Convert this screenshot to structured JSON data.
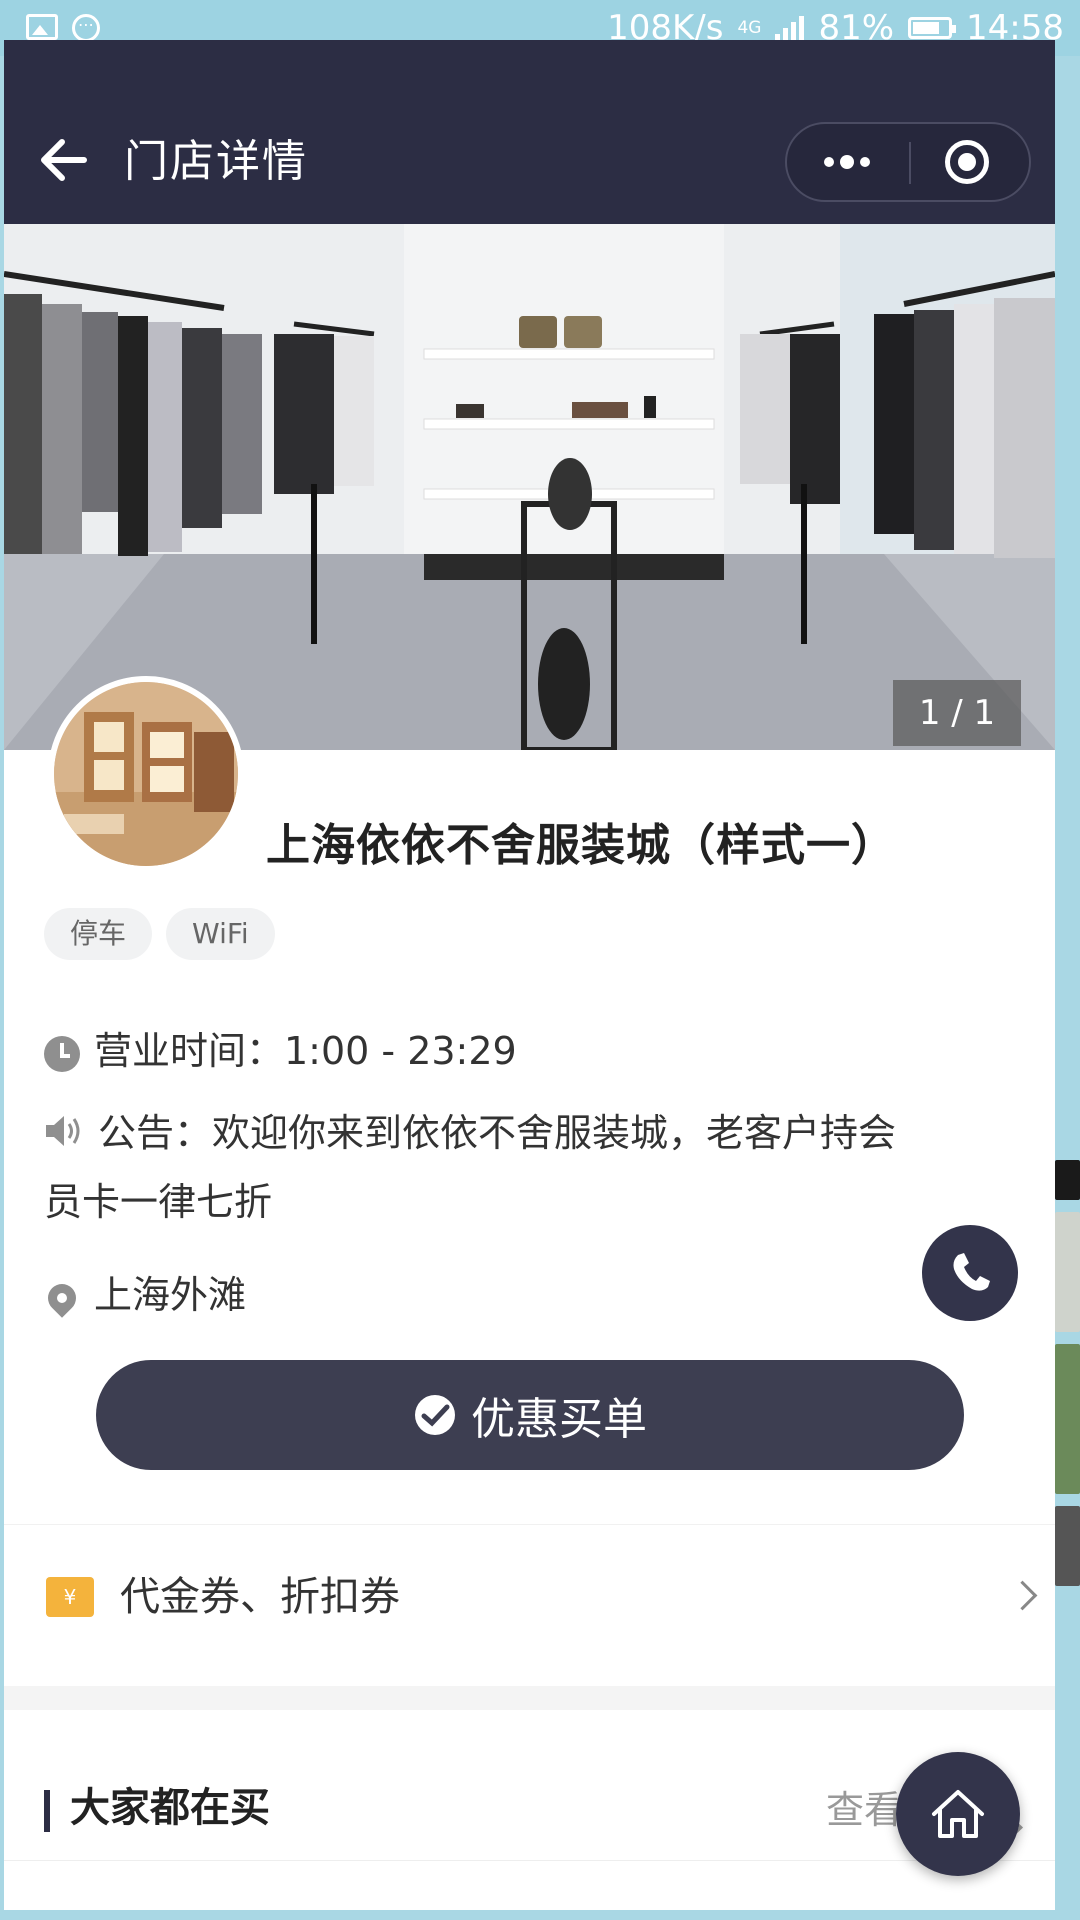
{
  "status_bar": {
    "speed": "108K/s",
    "network": "4G",
    "battery": "81%",
    "time": "14:58"
  },
  "navbar": {
    "title": "门店详情"
  },
  "banner": {
    "counter": "1 / 1"
  },
  "store": {
    "name": "上海依依不舍服装城（样式一）",
    "tags": [
      "停车",
      "WiFi"
    ],
    "hours": "营业时间：1:00 - 23:29",
    "notice_line1": "公告：欢迎你来到依依不舍服装城，老客户持会",
    "notice_line2": "员卡一律七折",
    "address": "上海外滩"
  },
  "pay_button": {
    "label": "优惠买单"
  },
  "coupon": {
    "icon_text": "¥",
    "label": "代金券、折扣券"
  },
  "section": {
    "title": "大家都在买",
    "see_more": "查看更多"
  },
  "colors": {
    "navbar": "#2c2d44",
    "primary_button": "#3d3e51",
    "coupon_icon": "#f4b33c",
    "status_bar": "#9dd3e2"
  }
}
